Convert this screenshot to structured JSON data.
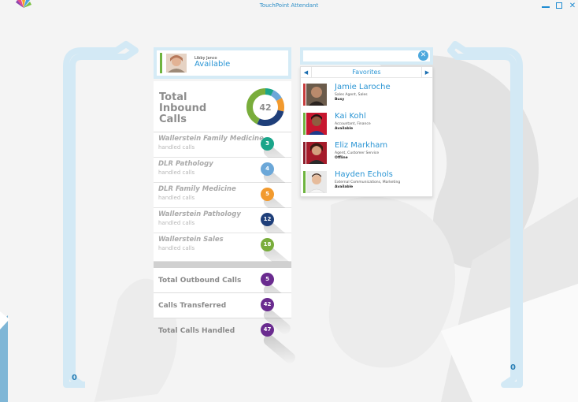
{
  "app": {
    "title": "TouchPoint Attendant"
  },
  "colors": {
    "accent": "#2a95d4",
    "available": "#6fb43f",
    "busy": "#c63b3b",
    "offline": "#8b1e2c"
  },
  "queues": {
    "left_count": "0",
    "right_count": "0"
  },
  "user": {
    "name": "Libby Janco",
    "status": "Available"
  },
  "stats": {
    "total_inbound_label": "Total Inbound Calls",
    "total_inbound_value": "42",
    "queues": [
      {
        "name": "Wallerstein Family Medicine",
        "sub": "handled calls",
        "value": "3",
        "color": "#1aa58a"
      },
      {
        "name": "DLR Pathology",
        "sub": "handled calls",
        "value": "4",
        "color": "#6ba7d8"
      },
      {
        "name": "DLR Family Medicine",
        "sub": "handled calls",
        "value": "5",
        "color": "#f29a2e"
      },
      {
        "name": "Wallerstein Pathology",
        "sub": "handled calls",
        "value": "12",
        "color": "#1f3f7a"
      },
      {
        "name": "Wallerstein Sales",
        "sub": "handled calls",
        "value": "18",
        "color": "#79ad3b"
      }
    ],
    "totals": [
      {
        "label": "Total Outbound Calls",
        "value": "5",
        "color": "#6a2b8f"
      },
      {
        "label": "Calls Transferred",
        "value": "42",
        "color": "#6a2b8f"
      },
      {
        "label": "Total Calls Handled",
        "value": "47",
        "color": "#6a2b8f"
      }
    ]
  },
  "search": {
    "value": "",
    "placeholder": ""
  },
  "favorites": {
    "title": "Favorites",
    "contacts": [
      {
        "name": "Jamie Laroche",
        "role": "Sales Agent, Sales",
        "status": "Busy",
        "status_color": "#c63b3b"
      },
      {
        "name": "Kai Kohl",
        "role": "Accountant, Finance",
        "status": "Available",
        "status_color": "#6fb43f"
      },
      {
        "name": "Eliz Markham",
        "role": "Agent, Customer Service",
        "status": "Offline",
        "status_color": "#8b1e2c"
      },
      {
        "name": "Hayden Echols",
        "role": "External Communications, Marketing",
        "status": "Available",
        "status_color": "#6fb43f"
      }
    ]
  }
}
